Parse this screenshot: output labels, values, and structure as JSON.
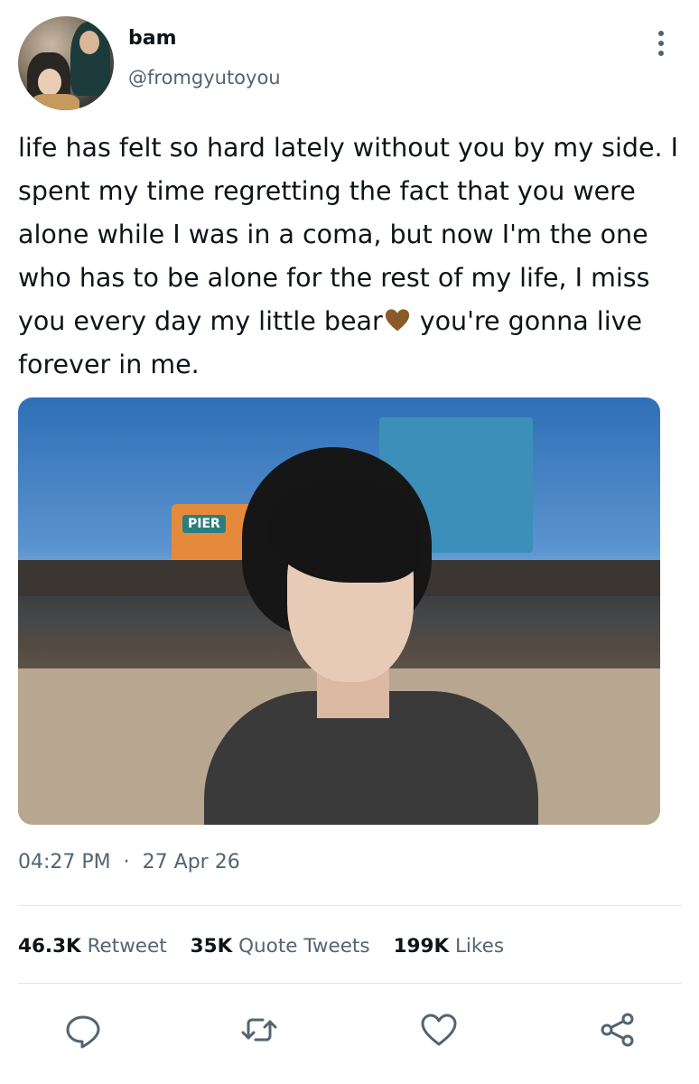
{
  "author": {
    "name": "bam",
    "handle": "@fromgyutoyou"
  },
  "tweet": {
    "text_before_emoji": "life has felt so hard lately without you by my side. I spent my time regretting the fact that you were alone while I was in a coma, but now I'm the one who has to be alone for the rest of my life, I miss you every day my little bear",
    "emoji": "brown-heart",
    "text_after_emoji": " you're gonna live forever in me.",
    "time": "04:27 PM",
    "separator": "·",
    "date": "27 Apr 26"
  },
  "media": {
    "pier_sign": "PIER"
  },
  "stats": {
    "retweets_count": "46.3K",
    "retweets_label": "Retweet",
    "quotes_count": "35K",
    "quotes_label": "Quote Tweets",
    "likes_count": "199K",
    "likes_label": "Likes"
  },
  "icons": {
    "reply": "reply-icon",
    "retweet": "retweet-icon",
    "like": "like-icon",
    "share": "share-icon",
    "more": "more-icon"
  },
  "colors": {
    "text": "#0f1419",
    "secondary": "#536471",
    "heart_emoji": "#8b5a2b"
  }
}
